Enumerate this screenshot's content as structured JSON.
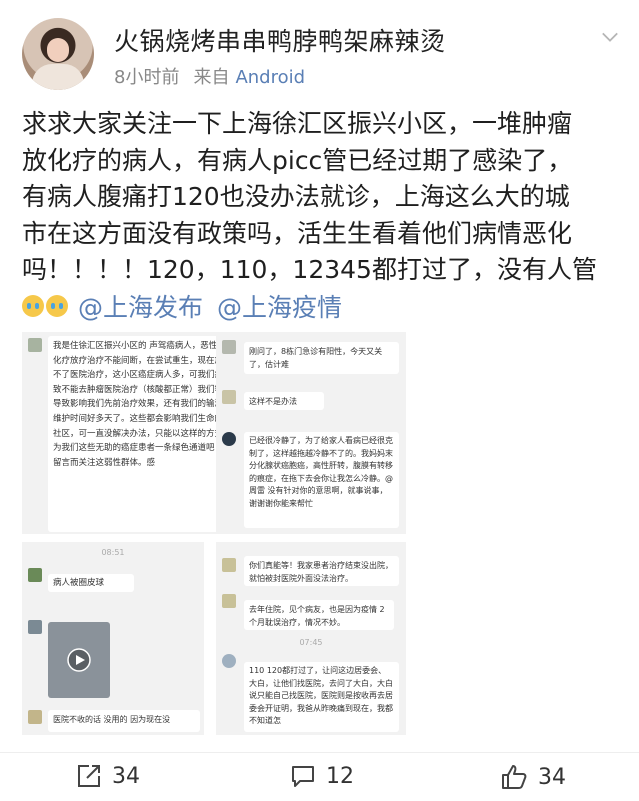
{
  "user": {
    "name": "火锅烧烤串串鸭脖鸭架麻辣烫",
    "time": "8小时前",
    "from_prefix": "来自",
    "source": "Android"
  },
  "post": {
    "lines": [
      "求求大家关注一下上海徐汇区振兴小区，一堆肿瘤",
      "放化疗的病人，有病人picc管已经过期了感染了，",
      "有病人腹痛打120也没办法就诊，上海这么大的城",
      "市在这方面没有政策吗，活生生看着他们病情恶化",
      "吗！！！！120，110，12345都打过了，没有人管"
    ],
    "mentions": [
      "@上海发布",
      "@上海疫情"
    ]
  },
  "screenshots": {
    "tl": {
      "text": "我是住徐汇区振兴小区的 声驾癌病人，恶性纽胞痕痕，要连续化疗放疗治疗不能间断，在尝试重生，现在放疗期间，可这周去不了医院治疗，这小区癌症病人多，可我们癌症病人因为这样导致不能去肿瘤医院治疗（核酸都正常）我们等不起，延误治疗会导致影响我们先前治疗效果，还有我们的输液港及picc 都超过维护时间好多天了。这些都会影响我们生命的，我们找过支委会社区，可一直没解决办法，只能以这样的方式，求助于你们，也为我们这些无助的癌症患者一条绿色通道吧 希望你们会看见这留言而关注这弱性群体。感"
    },
    "tr": {
      "b1": "刚问了，8栋门急诊有阳性，今天又关了，估计难",
      "b2": "这样不是办法",
      "b3": "已经很冷静了，为了给家人看病已经很克制了，这样越拖越冷静不了的。我妈妈末分化腺状癌胞癌，高性肝转，腹膜有转移的痕症，在拖下去会你让我怎么冷静。@周雷 没有针对你的意思啊，就事说事，谢谢谢你能来帮忙"
    },
    "bl": {
      "time": "08:51",
      "b1": "病人被圈皮球",
      "b2": "医院不收的话 没用的 因为现在没"
    },
    "br": {
      "b1": "你们真能等！我家患者治疗结束没出院，就怕被封医院外面没法治疗。",
      "b2": "去年住院，见个病友，也是因为疫情 2个月耽误治疗，情况不妙。",
      "time": "07:45",
      "b3": "110 120都打过了，让问这边居委会、大白，让他们找医院，去问了大白，大白说只能自己找医院，医院则是按收再去居委会开证明，我爸从昨晚痛到现在，我都不知道怎"
    }
  },
  "actions": {
    "repost": "34",
    "comment": "12",
    "like": "34"
  },
  "colors": {
    "link": "#5a7fb5",
    "meta": "#888888"
  }
}
